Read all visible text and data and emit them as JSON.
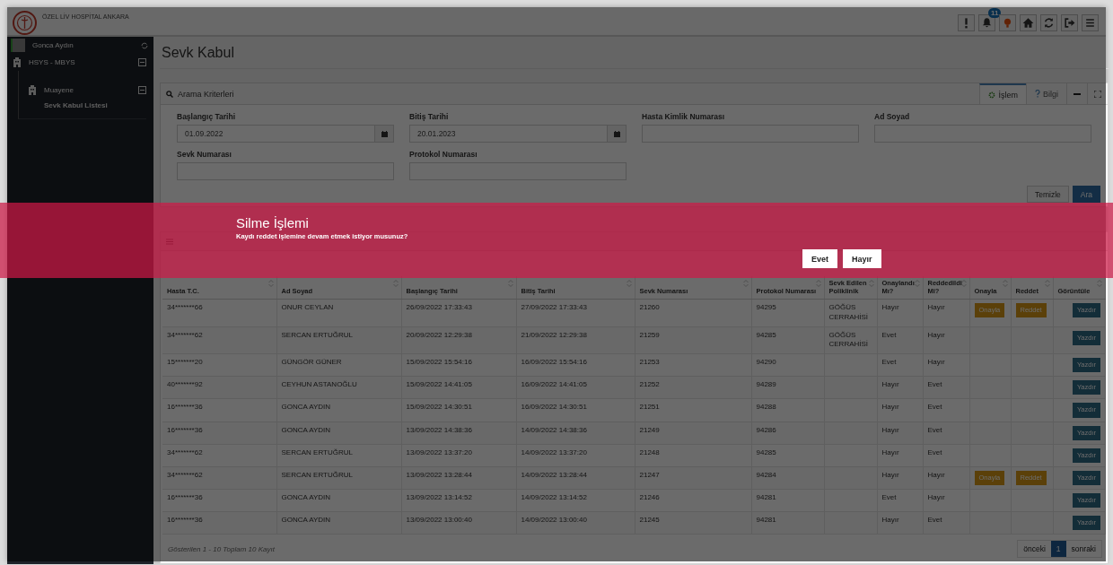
{
  "header": {
    "hospital_name": "ÖZEL LİV HOSPİTAL ANKARA",
    "notification_count": "11"
  },
  "sidebar": {
    "user_name": "Gonca Aydın",
    "modules": [
      {
        "label": "HSYS - MBYS",
        "expanded": true,
        "children": [
          {
            "label": "Muayene",
            "expanded": true,
            "children": [
              {
                "label": "Sevk Kabul Listesi"
              }
            ]
          }
        ]
      }
    ]
  },
  "page_title": "Sevk Kabul",
  "search_panel": {
    "title": "Arama Kriterleri",
    "tabs": [
      {
        "label": "İşlem",
        "selected": true
      },
      {
        "label": "Bilgi",
        "selected": false
      }
    ],
    "fields": [
      {
        "label": "Başlangıç Tarihi",
        "value": "01.09.2022",
        "kind": "date"
      },
      {
        "label": "Bitiş Tarihi",
        "value": "20.01.2023",
        "kind": "date"
      },
      {
        "label": "Hasta Kimlik Numarası",
        "kind": "text"
      },
      {
        "label": "Ad Soyad",
        "kind": "text"
      },
      {
        "label": "Sevk Numarası",
        "kind": "text"
      },
      {
        "label": "Protokol Numarası",
        "kind": "text"
      }
    ],
    "buttons": [
      {
        "label": "Temizle",
        "kind": "default"
      },
      {
        "label": "Ara",
        "kind": "primary"
      }
    ]
  },
  "table": {
    "columns": [
      "Hasta T.C.",
      "Ad Soyad",
      "Başlangıç Tarihi",
      "Bitiş Tarihi",
      "Sevk Numarası",
      "Protokol Numarası",
      "Sevk Edilen Poliklinik",
      "Onaylandı Mı?",
      "Reddedildi Mi?",
      "Onayla",
      "Reddet",
      "Görüntüle"
    ],
    "rows": [
      {
        "tc": "34*******66",
        "name": "ONUR CEYLAN",
        "start": "26/09/2022 17:33:43",
        "end": "27/09/2022 17:33:43",
        "sevk_no": "21260",
        "protokol": "94295",
        "poliklinik": "GÖĞÜS CERRAHİSİ",
        "onaylandi": "Hayır",
        "reddedildi": "Hayır",
        "onayla": "Onayla",
        "reddet": "Reddet",
        "yazdir": "Yazdır"
      },
      {
        "tc": "34*******62",
        "name": "SERCAN ERTUĞRUL",
        "start": "20/09/2022 12:29:38",
        "end": "21/09/2022 12:29:38",
        "sevk_no": "21259",
        "protokol": "94285",
        "poliklinik": "GÖĞÜS CERRAHİSİ",
        "onaylandi": "Evet",
        "reddedildi": "Hayır",
        "yazdir": "Yazdır"
      },
      {
        "tc": "15*******20",
        "name": "GÜNGÖR GÜNER",
        "start": "15/09/2022 15:54:16",
        "end": "16/09/2022 15:54:16",
        "sevk_no": "21253",
        "protokol": "94290",
        "onaylandi": "Evet",
        "reddedildi": "Hayır",
        "yazdir": "Yazdır"
      },
      {
        "tc": "40*******92",
        "name": "CEYHUN ASTANOĞLU",
        "start": "15/09/2022 14:41:05",
        "end": "16/09/2022 14:41:05",
        "sevk_no": "21252",
        "protokol": "94289",
        "onaylandi": "Hayır",
        "reddedildi": "Evet",
        "yazdir": "Yazdır"
      },
      {
        "tc": "16*******36",
        "name": "GONCA AYDIN",
        "start": "15/09/2022 14:30:51",
        "end": "16/09/2022 14:30:51",
        "sevk_no": "21251",
        "protokol": "94288",
        "onaylandi": "Hayır",
        "reddedildi": "Evet",
        "yazdir": "Yazdır"
      },
      {
        "tc": "16*******36",
        "name": "GONCA AYDIN",
        "start": "13/09/2022 14:38:36",
        "end": "14/09/2022 14:38:36",
        "sevk_no": "21249",
        "protokol": "94286",
        "onaylandi": "Hayır",
        "reddedildi": "Evet",
        "yazdir": "Yazdır"
      },
      {
        "tc": "34*******62",
        "name": "SERCAN ERTUĞRUL",
        "start": "13/09/2022 13:37:20",
        "end": "14/09/2022 13:37:20",
        "sevk_no": "21248",
        "protokol": "94285",
        "onaylandi": "Hayır",
        "reddedildi": "Evet",
        "yazdir": "Yazdır"
      },
      {
        "tc": "34*******62",
        "name": "SERCAN ERTUĞRUL",
        "start": "13/09/2022 13:28:44",
        "end": "14/09/2022 13:28:44",
        "sevk_no": "21247",
        "protokol": "94284",
        "onaylandi": "Hayır",
        "reddedildi": "Hayır",
        "onayla": "Onayla",
        "reddet": "Reddet",
        "yazdir": "Yazdır"
      },
      {
        "tc": "16*******36",
        "name": "GONCA AYDIN",
        "start": "13/09/2022 13:14:52",
        "end": "14/09/2022 13:14:52",
        "sevk_no": "21246",
        "protokol": "94281",
        "onaylandi": "Evet",
        "reddedildi": "Hayır",
        "yazdir": "Yazdır"
      },
      {
        "tc": "16*******36",
        "name": "GONCA AYDIN",
        "start": "13/09/2022 13:00:40",
        "end": "14/09/2022 13:00:40",
        "sevk_no": "21245",
        "protokol": "94281",
        "onaylandi": "Hayır",
        "reddedildi": "Evet",
        "yazdir": "Yazdır"
      }
    ]
  },
  "footer": {
    "info": "Gösterilen 1 - 10 Toplam 10 Kayıt",
    "pager": [
      {
        "label": "önceki",
        "selected": false
      },
      {
        "label": "1",
        "selected": true
      },
      {
        "label": "sonraki",
        "selected": false
      }
    ]
  },
  "modal": {
    "title": "Silme İşlemi",
    "message": "Kaydı reddet işlemine devam etmek istiyor musunuz?",
    "buttons": [
      "Evet",
      "Hayır"
    ]
  }
}
